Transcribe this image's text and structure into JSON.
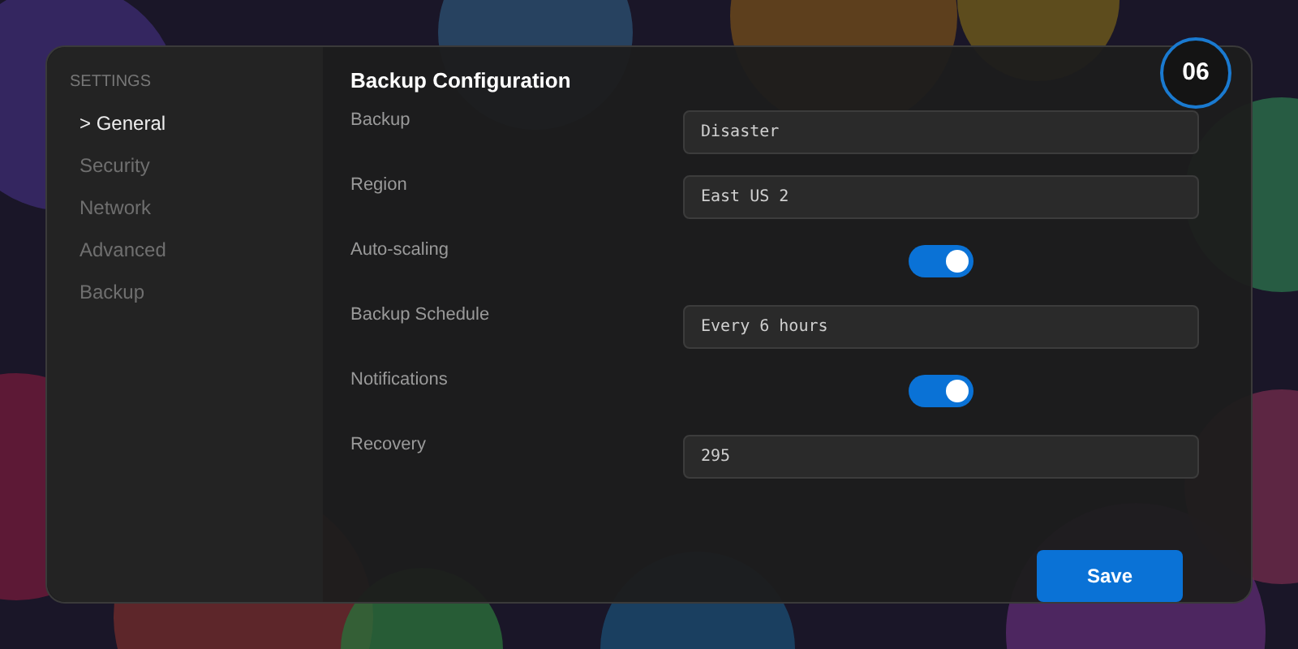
{
  "sidebar": {
    "heading": "SETTINGS",
    "items": [
      {
        "label": "> General",
        "selected": true
      },
      {
        "label": "Security",
        "selected": false
      },
      {
        "label": "Network",
        "selected": false
      },
      {
        "label": "Advanced",
        "selected": false
      },
      {
        "label": "Backup",
        "selected": false
      }
    ]
  },
  "title": "Backup Configuration",
  "step_badge": "06",
  "fields": [
    {
      "kind": "text",
      "label": "Backup",
      "value": "Disaster"
    },
    {
      "kind": "text",
      "label": "Region",
      "value": "East US 2"
    },
    {
      "kind": "toggle",
      "label": "Auto-scaling",
      "on": true
    },
    {
      "kind": "text",
      "label": "Backup Schedule",
      "value": "Every 6 hours"
    },
    {
      "kind": "toggle",
      "label": "Notifications",
      "on": true
    },
    {
      "kind": "text",
      "label": "Recovery",
      "value": "295"
    }
  ],
  "save_button": "Save"
}
